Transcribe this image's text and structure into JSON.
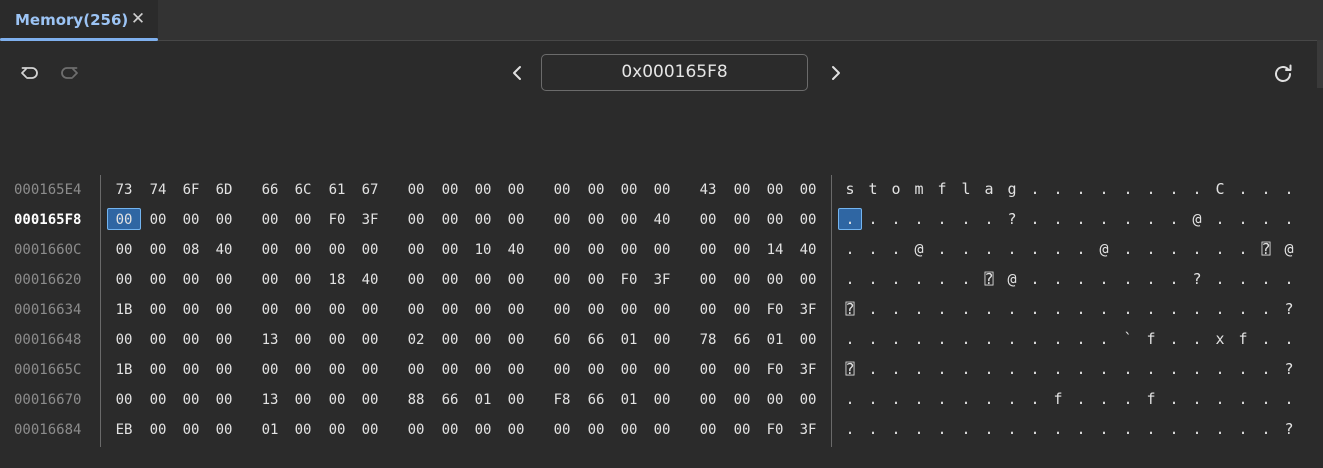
{
  "tab": {
    "label": "Memory(256)",
    "close_glyph": "✕"
  },
  "toolbar": {
    "undo_icon": "undo-icon",
    "redo_icon": "redo-icon",
    "prev_icon": "chevron-left-icon",
    "next_icon": "chevron-right-icon",
    "refresh_icon": "refresh-icon",
    "address_value": "0x000165F8"
  },
  "colors": {
    "accent": "#7fb0ee",
    "selection_bg": "#2f66a3",
    "selection_border": "#73b4f0"
  },
  "memory": {
    "selected_row": 1,
    "selected_col": 0,
    "rows": [
      {
        "address": "000165E4",
        "bytes": [
          "73",
          "74",
          "6F",
          "6D",
          "66",
          "6C",
          "61",
          "67",
          "00",
          "00",
          "00",
          "00",
          "00",
          "00",
          "00",
          "00",
          "43",
          "00",
          "00",
          "00"
        ],
        "ascii": [
          "s",
          "t",
          "o",
          "m",
          "f",
          "l",
          "a",
          "g",
          ".",
          ".",
          ".",
          ".",
          ".",
          ".",
          ".",
          ".",
          "C",
          ".",
          ".",
          "."
        ]
      },
      {
        "address": "000165F8",
        "bytes": [
          "00",
          "00",
          "00",
          "00",
          "00",
          "00",
          "F0",
          "3F",
          "00",
          "00",
          "00",
          "00",
          "00",
          "00",
          "00",
          "40",
          "00",
          "00",
          "00",
          "00"
        ],
        "ascii": [
          ".",
          ".",
          ".",
          ".",
          ".",
          ".",
          ".",
          "?",
          ".",
          ".",
          ".",
          ".",
          ".",
          ".",
          ".",
          "@",
          ".",
          ".",
          ".",
          "."
        ]
      },
      {
        "address": "0001660C",
        "bytes": [
          "00",
          "00",
          "08",
          "40",
          "00",
          "00",
          "00",
          "00",
          "00",
          "00",
          "10",
          "40",
          "00",
          "00",
          "00",
          "00",
          "00",
          "00",
          "14",
          "40"
        ],
        "ascii": [
          ".",
          ".",
          ".",
          "@",
          ".",
          ".",
          ".",
          ".",
          ".",
          ".",
          ".",
          "@",
          ".",
          ".",
          ".",
          ".",
          ".",
          ".",
          "⍰",
          "@"
        ]
      },
      {
        "address": "00016620",
        "bytes": [
          "00",
          "00",
          "00",
          "00",
          "00",
          "00",
          "18",
          "40",
          "00",
          "00",
          "00",
          "00",
          "00",
          "00",
          "F0",
          "3F",
          "00",
          "00",
          "00",
          "00"
        ],
        "ascii": [
          ".",
          ".",
          ".",
          ".",
          ".",
          ".",
          "⍰",
          "@",
          ".",
          ".",
          ".",
          ".",
          ".",
          ".",
          ".",
          "?",
          ".",
          ".",
          ".",
          "."
        ]
      },
      {
        "address": "00016634",
        "bytes": [
          "1B",
          "00",
          "00",
          "00",
          "00",
          "00",
          "00",
          "00",
          "00",
          "00",
          "00",
          "00",
          "00",
          "00",
          "00",
          "00",
          "00",
          "00",
          "F0",
          "3F"
        ],
        "ascii": [
          "⍰",
          ".",
          ".",
          ".",
          ".",
          ".",
          ".",
          ".",
          ".",
          ".",
          ".",
          ".",
          ".",
          ".",
          ".",
          ".",
          ".",
          ".",
          ".",
          "?"
        ]
      },
      {
        "address": "00016648",
        "bytes": [
          "00",
          "00",
          "00",
          "00",
          "13",
          "00",
          "00",
          "00",
          "02",
          "00",
          "00",
          "00",
          "60",
          "66",
          "01",
          "00",
          "78",
          "66",
          "01",
          "00"
        ],
        "ascii": [
          ".",
          ".",
          ".",
          ".",
          ".",
          ".",
          ".",
          ".",
          ".",
          ".",
          ".",
          ".",
          "`",
          "f",
          ".",
          ".",
          "x",
          "f",
          ".",
          "."
        ]
      },
      {
        "address": "0001665C",
        "bytes": [
          "1B",
          "00",
          "00",
          "00",
          "00",
          "00",
          "00",
          "00",
          "00",
          "00",
          "00",
          "00",
          "00",
          "00",
          "00",
          "00",
          "00",
          "00",
          "F0",
          "3F"
        ],
        "ascii": [
          "⍰",
          ".",
          ".",
          ".",
          ".",
          ".",
          ".",
          ".",
          ".",
          ".",
          ".",
          ".",
          ".",
          ".",
          ".",
          ".",
          ".",
          ".",
          ".",
          "?"
        ]
      },
      {
        "address": "00016670",
        "bytes": [
          "00",
          "00",
          "00",
          "00",
          "13",
          "00",
          "00",
          "00",
          "88",
          "66",
          "01",
          "00",
          "F8",
          "66",
          "01",
          "00",
          "00",
          "00",
          "00",
          "00"
        ],
        "ascii": [
          ".",
          ".",
          ".",
          ".",
          ".",
          ".",
          ".",
          ".",
          ".",
          "f",
          ".",
          ".",
          ".",
          "f",
          ".",
          ".",
          ".",
          ".",
          ".",
          "."
        ]
      },
      {
        "address": "00016684",
        "bytes": [
          "EB",
          "00",
          "00",
          "00",
          "01",
          "00",
          "00",
          "00",
          "00",
          "00",
          "00",
          "00",
          "00",
          "00",
          "00",
          "00",
          "00",
          "00",
          "F0",
          "3F"
        ],
        "ascii": [
          ".",
          ".",
          ".",
          ".",
          ".",
          ".",
          ".",
          ".",
          ".",
          ".",
          ".",
          ".",
          ".",
          ".",
          ".",
          ".",
          ".",
          ".",
          ".",
          "?"
        ]
      }
    ]
  }
}
